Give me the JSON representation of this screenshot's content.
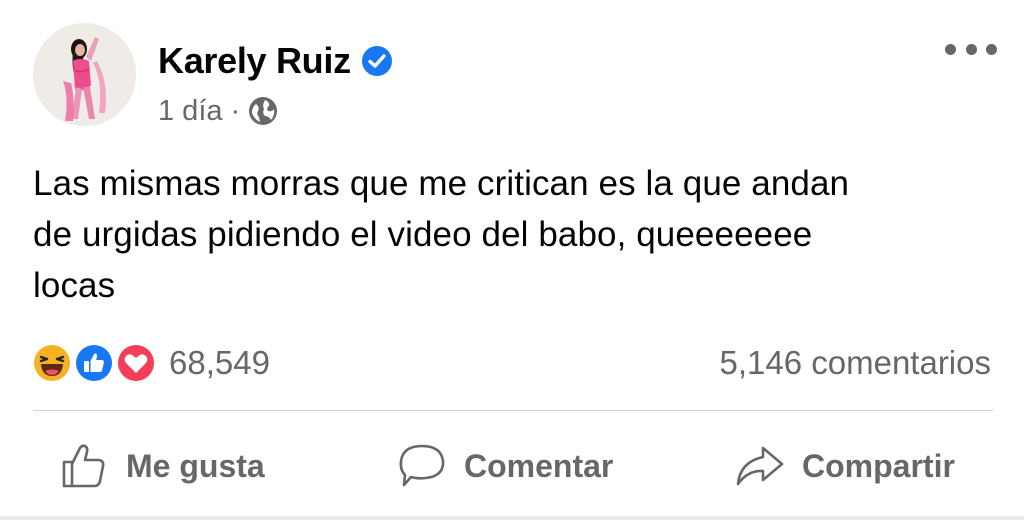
{
  "post": {
    "author": {
      "name": "Karely Ruiz",
      "verified": true
    },
    "meta": {
      "time": "1 día",
      "separator": "·",
      "audience_icon": "globe-icon"
    },
    "more_icon": "more-options-icon",
    "text_lines": [
      "Las mismas morras que me critican es la que andan",
      "de urgidas pidiendo el video del babo, queeeeeee",
      "locas"
    ],
    "reactions": {
      "icons": [
        "haha-icon",
        "like-icon",
        "love-icon"
      ],
      "count": "68,549"
    },
    "comments_count": "5,146 comentarios",
    "actions": {
      "like": "Me gusta",
      "comment": "Comentar",
      "share": "Compartir"
    }
  },
  "colors": {
    "text_primary": "#050505",
    "text_secondary": "#65676b",
    "verified_blue": "#1877f2",
    "like_blue": "#1877f2",
    "love_red": "#f33e58",
    "haha_yellow": "#f7b125",
    "divider": "#ced0d4"
  }
}
